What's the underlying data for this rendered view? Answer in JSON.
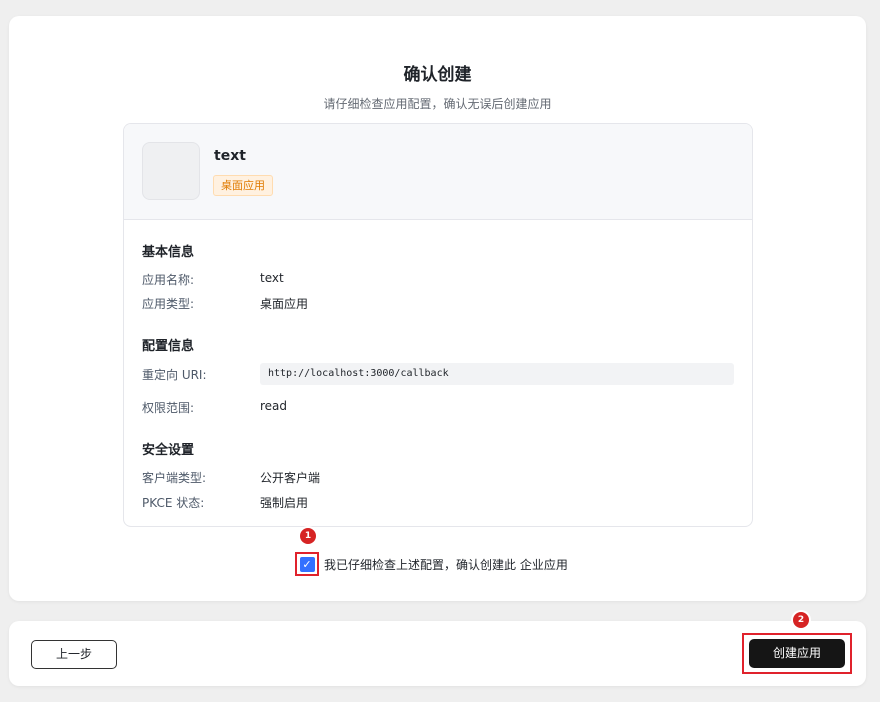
{
  "header": {
    "title": "确认创建",
    "subtitle": "请仔细检查应用配置，确认无误后创建应用"
  },
  "app": {
    "name": "text",
    "type_badge": "桌面应用"
  },
  "basic_info": {
    "title": "基本信息",
    "rows": [
      {
        "label": "应用名称:",
        "value": "text"
      },
      {
        "label": "应用类型:",
        "value": "桌面应用"
      }
    ]
  },
  "config_info": {
    "title": "配置信息",
    "redirect_label": "重定向 URI:",
    "redirect_value": "http://localhost:3000/callback",
    "scope_label": "权限范围:",
    "scope_value": "read"
  },
  "security": {
    "title": "安全设置",
    "rows": [
      {
        "label": "客户端类型:",
        "value": "公开客户端"
      },
      {
        "label": "PKCE 状态:",
        "value": "强制启用"
      }
    ]
  },
  "confirm": {
    "checked": true,
    "text": "我已仔细检查上述配置，确认创建此 企业应用"
  },
  "footer": {
    "prev_label": "上一步",
    "create_label": "创建应用"
  },
  "markers": [
    "1",
    "2"
  ],
  "colors": {
    "accent": "#3370ff",
    "badge_text": "#e07b00",
    "badge_bg": "#fff1e0",
    "primary_button": "#151515",
    "highlight": "#e0222c"
  },
  "icons": {
    "checkbox": "check-icon"
  }
}
